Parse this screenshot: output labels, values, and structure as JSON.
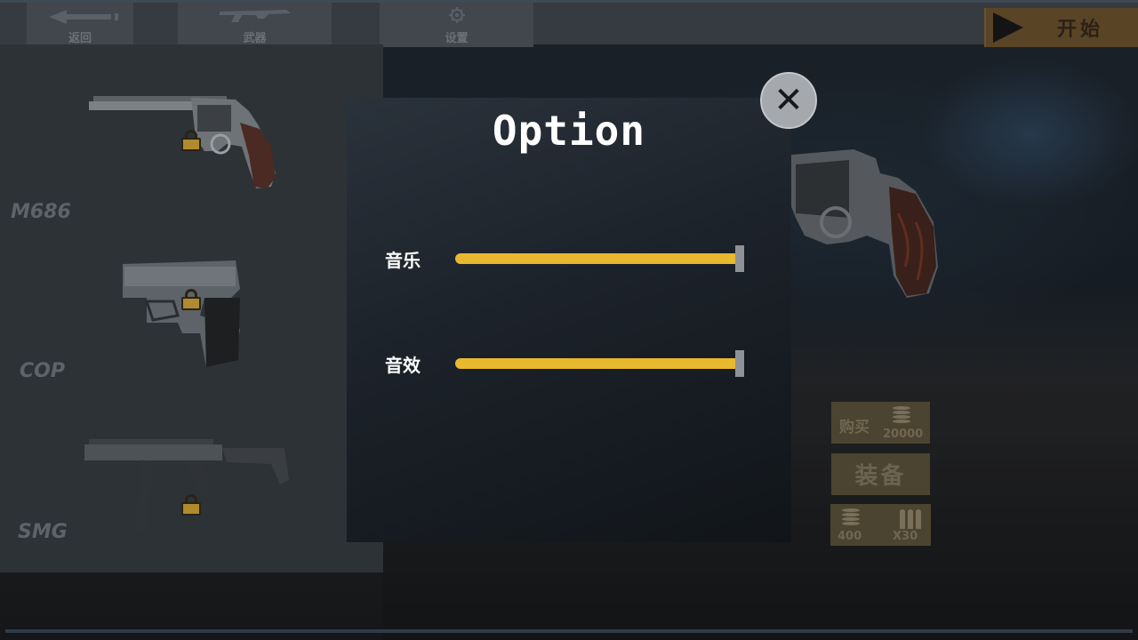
{
  "topbar": {
    "back_label": "返回",
    "weapons_label": "武器",
    "settings_label": "设置",
    "start_label": "开始"
  },
  "weapons": [
    {
      "name": "M686",
      "locked": true
    },
    {
      "name": "COP",
      "locked": true
    },
    {
      "name": "SMG",
      "locked": true
    }
  ],
  "shop": {
    "buy_label": "购买",
    "buy_price": "20000",
    "equip_label": "装备",
    "ammo_price": "400",
    "ammo_amount": "X30"
  },
  "modal": {
    "title": "Option",
    "sliders": [
      {
        "label": "音乐",
        "value": 1.0
      },
      {
        "label": "音效",
        "value": 1.0
      }
    ],
    "close_symbol": "✕"
  },
  "colors": {
    "accent": "#e8b92e",
    "start_button": "#5a4426",
    "panel": "#2d3237"
  },
  "icons": {
    "back": "back-arrow-icon",
    "weapons": "rifle-icon",
    "settings": "gear-icon",
    "start": "play-arrow-icon",
    "lock": "padlock-icon",
    "coins": "coin-stack-icon",
    "ammo": "bullets-icon",
    "close": "close-icon"
  }
}
